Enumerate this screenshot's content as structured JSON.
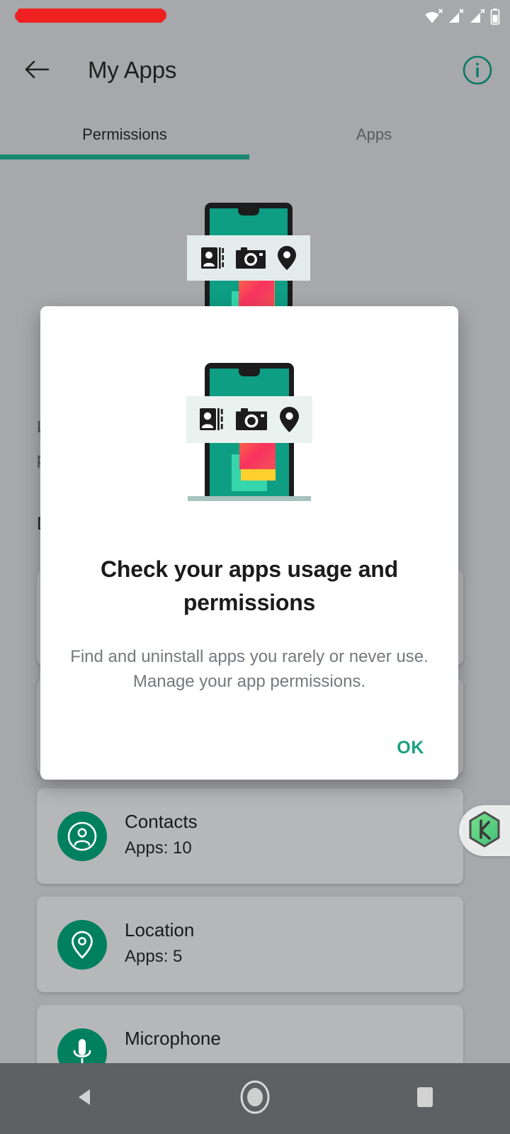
{
  "status_bar": {
    "redaction_label": "",
    "icons": [
      "wifi-no-internet-icon",
      "cellular-1-no-service-icon",
      "cellular-2-no-service-icon",
      "battery-icon"
    ]
  },
  "app_bar": {
    "back_label": "",
    "title": "My Apps",
    "info_label": ""
  },
  "tabs": [
    {
      "label": "Permissions",
      "active": true
    },
    {
      "label": "Apps",
      "active": false
    }
  ],
  "background": {
    "description_line1": "L",
    "description_line2": "p",
    "section_title": "D",
    "permissions": [
      {
        "name": "Contacts",
        "apps": "Apps: 10",
        "icon": "contacts-icon"
      },
      {
        "name": "Location",
        "apps": "Apps: 5",
        "icon": "location-pin-icon"
      },
      {
        "name": "Microphone",
        "apps": "",
        "icon": "microphone-icon"
      }
    ],
    "floating_widget_label": "k"
  },
  "dialog": {
    "title": "Check your apps usage and permissions",
    "body": "Find and uninstall apps you rarely or never use. Manage your app permissions.",
    "ok_label": "OK",
    "illustration": {
      "icons": [
        "contacts-book-icon",
        "camera-icon",
        "location-pin-icon"
      ]
    }
  },
  "nav_bar": {
    "back": "back-triangle-icon",
    "home": "home-circle-icon",
    "recents": "recents-square-icon"
  },
  "colors": {
    "accent_green": "#18876f",
    "ok_green": "#1aa083",
    "icon_green": "#00805f",
    "scrim_gray": "#a6a8ab",
    "card_gray": "#b6b7b9",
    "redaction_red": "#ee2020",
    "nav_gray": "#5e6063"
  }
}
